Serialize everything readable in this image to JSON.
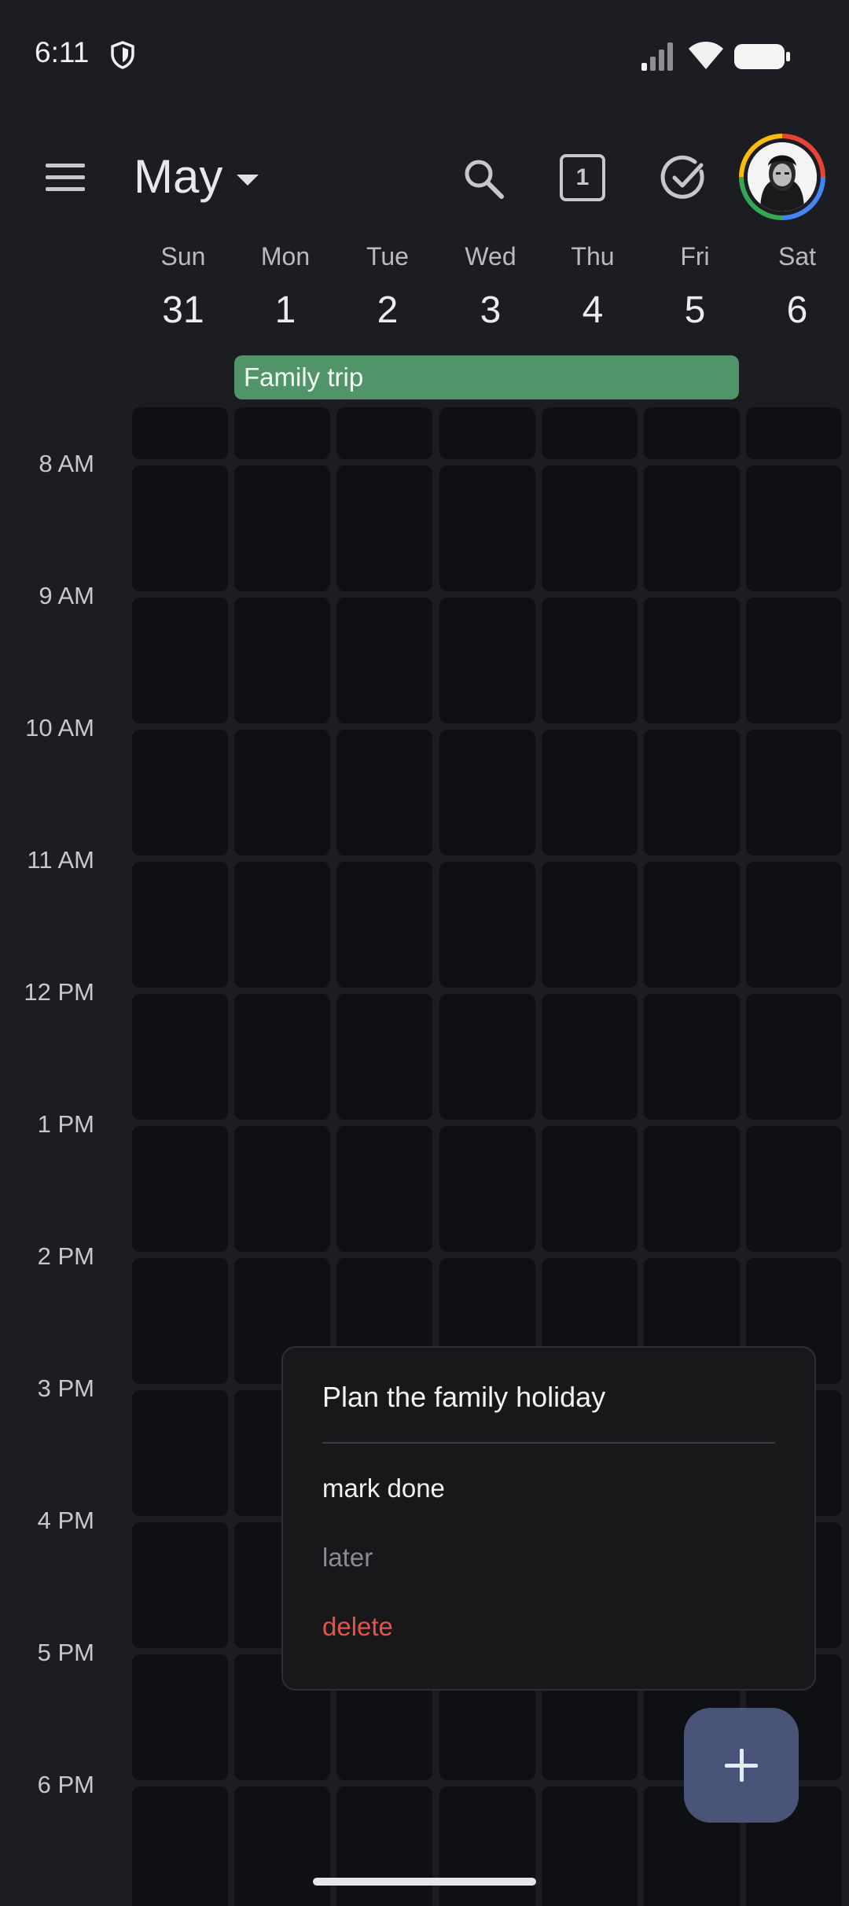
{
  "status_bar": {
    "time": "6:11",
    "icons": [
      "shield-icon",
      "signal-icon",
      "wifi-icon",
      "battery-icon"
    ]
  },
  "header": {
    "month": "May",
    "today_badge": "1",
    "icons": [
      "menu-icon",
      "search-icon",
      "today-icon",
      "tasks-icon",
      "avatar"
    ]
  },
  "week": {
    "days": [
      {
        "name": "Sun",
        "num": "31"
      },
      {
        "name": "Mon",
        "num": "1"
      },
      {
        "name": "Tue",
        "num": "2"
      },
      {
        "name": "Wed",
        "num": "3"
      },
      {
        "name": "Thu",
        "num": "4"
      },
      {
        "name": "Fri",
        "num": "5"
      },
      {
        "name": "Sat",
        "num": "6"
      }
    ]
  },
  "allday_event": {
    "title": "Family trip",
    "color": "#51946a"
  },
  "time_labels": [
    "8 AM",
    "9 AM",
    "10 AM",
    "11 AM",
    "12 PM",
    "1 PM",
    "2 PM",
    "3 PM",
    "4 PM",
    "5 PM",
    "6 PM"
  ],
  "popup": {
    "title": "Plan the family holiday",
    "actions": {
      "done": "mark done",
      "later": "later",
      "delete": "delete"
    },
    "delete_color": "#e5534b"
  },
  "fab": {
    "icon": "plus-icon",
    "color": "#485578"
  }
}
